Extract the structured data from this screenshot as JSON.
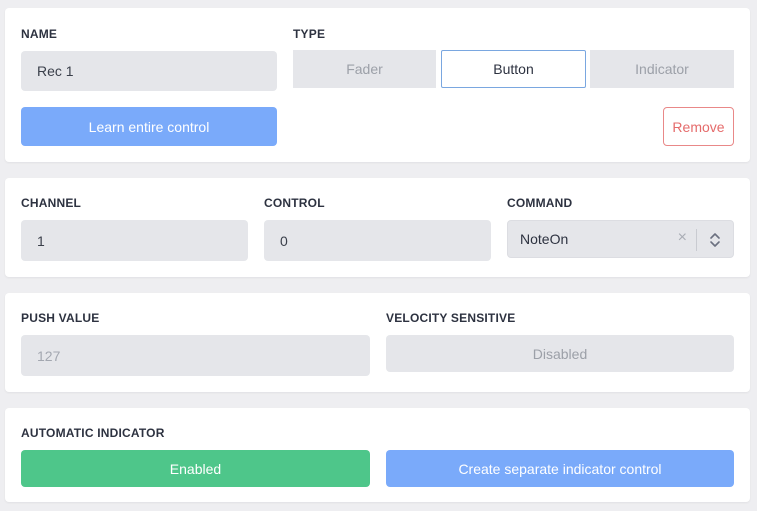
{
  "card1": {
    "name_label": "NAME",
    "name_value": "Rec 1",
    "type_label": "TYPE",
    "type_options": [
      "Fader",
      "Button",
      "Indicator"
    ],
    "type_selected": "Button",
    "learn_label": "Learn entire control",
    "remove_label": "Remove"
  },
  "card2": {
    "channel_label": "CHANNEL",
    "channel_value": "1",
    "control_label": "CONTROL",
    "control_value": "0",
    "command_label": "COMMAND",
    "command_value": "NoteOn",
    "clear_glyph": "×"
  },
  "card3": {
    "push_label": "PUSH VALUE",
    "push_value": "127",
    "velocity_label": "VELOCITY SENSITIVE",
    "velocity_value": "Disabled"
  },
  "card4": {
    "auto_label": "AUTOMATIC INDICATOR",
    "enabled_label": "Enabled",
    "create_label": "Create separate indicator control"
  },
  "colors": {
    "background": "#eeeef1",
    "card": "#ffffff",
    "field": "#e5e6ea",
    "accent_blue": "#7aaafa",
    "selected_border": "#7aa7e0",
    "success_green": "#4ec68a",
    "danger": "#e56b6b"
  },
  "icons": {
    "clear": "close-icon",
    "select_toggle": "chevron-up-down-icon"
  }
}
